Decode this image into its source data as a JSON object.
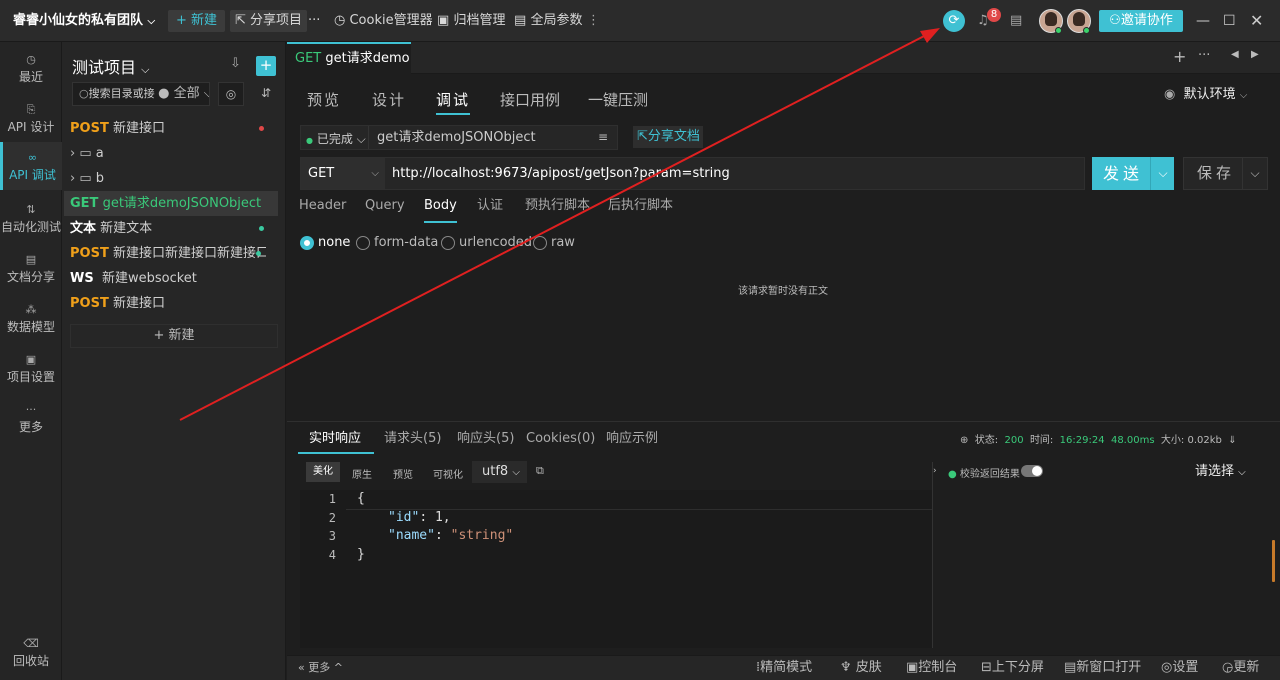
{
  "topbar": {
    "team_name": "睿睿小仙女的私有团队",
    "new_label": "+ 新建",
    "share_label": "分享项目",
    "more": "···",
    "cookie_label": "Cookie管理器",
    "archive_label": "归档管理",
    "global_params_label": "全局参数",
    "notification_count": "8",
    "invite_label": "邀请协作"
  },
  "rail": {
    "items": [
      {
        "label": "最近",
        "icon": "clock-icon"
      },
      {
        "label": "API 设计",
        "icon": "design-icon"
      },
      {
        "label": "API 调试",
        "icon": "debug-icon"
      },
      {
        "label": "自动化测试",
        "icon": "flow-icon"
      },
      {
        "label": "文档分享",
        "icon": "doc-icon"
      },
      {
        "label": "数据模型",
        "icon": "model-icon"
      },
      {
        "label": "项目设置",
        "icon": "settings-icon"
      },
      {
        "label": "更多",
        "icon": "more-icon"
      }
    ],
    "trash_label": "回收站"
  },
  "project": {
    "title": "测试项目",
    "search_placeholder": "搜索目录或接",
    "filter_label": "全部",
    "tree": [
      {
        "method": "POST",
        "name": "新建接口",
        "dot": "#e04848"
      },
      {
        "method": "",
        "name": "a",
        "folder": true
      },
      {
        "method": "",
        "name": "b",
        "folder": true
      },
      {
        "method": "GET",
        "name": "get请求demoJSONObject",
        "selected": true
      },
      {
        "method": "文本",
        "name": "新建文本",
        "dot": "#3ac9a0"
      },
      {
        "method": "POST",
        "name": "新建接口新建接口新建接口",
        "dot": "#3ac9a0"
      },
      {
        "method": "WS",
        "name": "新建websocket"
      },
      {
        "method": "POST",
        "name": "新建接口"
      }
    ],
    "new_label": "+ 新建"
  },
  "tab": {
    "method": "GET",
    "name": "get请求demo"
  },
  "subtabs": [
    "预览",
    "设计",
    "调试",
    "接口用例",
    "一键压测"
  ],
  "env_label": "默认环境",
  "request": {
    "status": "已完成",
    "name": "get请求demoJSONObject",
    "share_doc": "分享文档",
    "method": "GET",
    "url": "http://localhost:9673/apipost/getJson?param=string",
    "send": "发送",
    "save": "保存"
  },
  "body_tabs": [
    "Header",
    "Query",
    "Body",
    "认证",
    "预执行脚本",
    "后执行脚本"
  ],
  "body_modes": [
    "none",
    "form-data",
    "urlencoded",
    "raw"
  ],
  "empty_body": "该请求暂时没有正文",
  "response": {
    "tabs": [
      "实时响应",
      "请求头(5)",
      "响应头(5)",
      "Cookies(0)",
      "响应示例"
    ],
    "status_label": "状态:",
    "status": "200",
    "time_label": "时间:",
    "time": "16:29:24",
    "duration": "48.00ms",
    "size_label": "大小:",
    "size": "0.02kb",
    "view_modes": [
      "美化",
      "原生",
      "预览",
      "可视化"
    ],
    "encoding": "utf8",
    "validate_label": "校验返回结果",
    "select_placeholder": "请选择",
    "code_lines": [
      {
        "n": "1",
        "text": "{"
      },
      {
        "n": "2",
        "key": "\"id\"",
        "val": " 1,"
      },
      {
        "n": "3",
        "key": "\"name\"",
        "sval": "\"string\""
      },
      {
        "n": "4",
        "text": "}"
      }
    ]
  },
  "statusbar": {
    "more": "更多",
    "items": [
      "精简模式",
      "皮肤",
      "控制台",
      "上下分屏",
      "新窗口打开",
      "设置",
      "更新"
    ]
  }
}
